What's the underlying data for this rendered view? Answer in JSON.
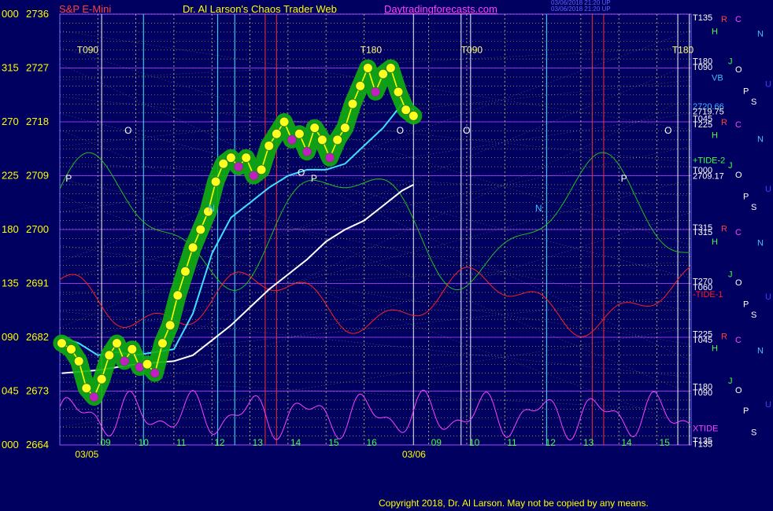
{
  "header": {
    "symbol": "S&P E-Mini",
    "title": "Dr. Al Larson's Chaos Trader Web",
    "site": "Daytradingforecasts.com",
    "timestamp_1": "03/06/2018 21:20 UP",
    "timestamp_2": "03/06/2018 21:20 UP"
  },
  "footer": {
    "copyright": "Copyright 2018, Dr. Al Larson. May not be copied by any means."
  },
  "colors": {
    "background": "#000060",
    "price_text": "#ffff00",
    "header_symbol": "#ff4040",
    "header_title": "#ffff00",
    "header_site": "#ff40ff",
    "grid": "#7070ff",
    "ema_fast": "#40e0ff",
    "ema_slow": "#ffffff",
    "price": "#ffff00",
    "tide_minus_1": "#ff2020",
    "tide_plus_2": "#20c020",
    "xtide": "#ff40ff"
  },
  "chart_data": {
    "type": "line",
    "ylim": [
      2664,
      2736
    ],
    "y_ticks": [
      {
        "angle": "000",
        "price": "2736"
      },
      {
        "angle": "315",
        "price": "2727"
      },
      {
        "angle": "270",
        "price": "2718"
      },
      {
        "angle": "225",
        "price": "2709"
      },
      {
        "angle": "180",
        "price": "2700"
      },
      {
        "angle": "135",
        "price": "2691"
      },
      {
        "angle": "090",
        "price": "2682"
      },
      {
        "angle": "045",
        "price": "2673"
      },
      {
        "angle": "000",
        "price": "2664"
      }
    ],
    "x_hours": [
      {
        "x": 1,
        "label": "09"
      },
      {
        "x": 2,
        "label": "10"
      },
      {
        "x": 3,
        "label": "11"
      },
      {
        "x": 4,
        "label": "12"
      },
      {
        "x": 5,
        "label": "13"
      },
      {
        "x": 6,
        "label": "14"
      },
      {
        "x": 7,
        "label": "15"
      },
      {
        "x": 8,
        "label": "16"
      },
      {
        "x": 9.7,
        "label": "09"
      },
      {
        "x": 10.7,
        "label": "10"
      },
      {
        "x": 11.7,
        "label": "11"
      },
      {
        "x": 12.7,
        "label": "12"
      },
      {
        "x": 13.7,
        "label": "13"
      },
      {
        "x": 14.7,
        "label": "14"
      },
      {
        "x": 15.7,
        "label": "15"
      }
    ],
    "dates": [
      {
        "x": 0.4,
        "label": "03/05"
      },
      {
        "x": 9,
        "label": "03/06"
      }
    ],
    "x_range": [
      0,
      16.6
    ],
    "price_series": {
      "name": "",
      "points": [
        [
          0.05,
          2681
        ],
        [
          0.3,
          2680
        ],
        [
          0.5,
          2678
        ],
        [
          0.7,
          2673.5
        ],
        [
          0.9,
          2672
        ],
        [
          1.1,
          2675
        ],
        [
          1.3,
          2679
        ],
        [
          1.5,
          2681
        ],
        [
          1.7,
          2678
        ],
        [
          1.9,
          2680
        ],
        [
          2.1,
          2677
        ],
        [
          2.3,
          2677.5
        ],
        [
          2.5,
          2676
        ],
        [
          2.7,
          2681
        ],
        [
          2.9,
          2684
        ],
        [
          3.1,
          2689
        ],
        [
          3.3,
          2693
        ],
        [
          3.5,
          2697
        ],
        [
          3.7,
          2700
        ],
        [
          3.9,
          2703
        ],
        [
          4.1,
          2708
        ],
        [
          4.3,
          2711
        ],
        [
          4.5,
          2712
        ],
        [
          4.7,
          2710.5
        ],
        [
          4.9,
          2712
        ],
        [
          5.1,
          2709
        ],
        [
          5.3,
          2710
        ],
        [
          5.5,
          2714
        ],
        [
          5.7,
          2716
        ],
        [
          5.9,
          2718
        ],
        [
          6.1,
          2715
        ],
        [
          6.3,
          2716
        ],
        [
          6.5,
          2713
        ],
        [
          6.7,
          2717
        ],
        [
          6.9,
          2715
        ],
        [
          7.1,
          2712
        ],
        [
          7.3,
          2715
        ],
        [
          7.5,
          2717
        ],
        [
          7.7,
          2721
        ],
        [
          7.9,
          2724
        ],
        [
          8.1,
          2727
        ],
        [
          8.3,
          2723
        ],
        [
          8.5,
          2726
        ],
        [
          8.7,
          2727
        ],
        [
          8.9,
          2723
        ],
        [
          9.1,
          2720
        ],
        [
          9.3,
          2719
        ]
      ]
    },
    "ema_fast": {
      "name": "",
      "points": [
        [
          0.05,
          2682
        ],
        [
          0.5,
          2681
        ],
        [
          1,
          2679
        ],
        [
          1.5,
          2679.5
        ],
        [
          2,
          2679
        ],
        [
          2.5,
          2679.5
        ],
        [
          3,
          2680
        ],
        [
          3.5,
          2686
        ],
        [
          3.8,
          2692
        ],
        [
          4,
          2696
        ],
        [
          4.5,
          2702
        ],
        [
          5,
          2704.5
        ],
        [
          5.5,
          2707
        ],
        [
          6,
          2709
        ],
        [
          6.5,
          2710
        ],
        [
          7,
          2710
        ],
        [
          7.5,
          2711
        ],
        [
          8,
          2714
        ],
        [
          8.5,
          2717
        ],
        [
          9,
          2721
        ],
        [
          9.3,
          2720
        ]
      ]
    },
    "ema_slow": {
      "name": "",
      "points": [
        [
          0.05,
          2676
        ],
        [
          1,
          2676.5
        ],
        [
          2,
          2677.5
        ],
        [
          3,
          2678
        ],
        [
          3.5,
          2679
        ],
        [
          4,
          2681.5
        ],
        [
          4.5,
          2684
        ],
        [
          5,
          2687
        ],
        [
          5.5,
          2690
        ],
        [
          6,
          2692.5
        ],
        [
          6.5,
          2695
        ],
        [
          7,
          2698
        ],
        [
          7.5,
          2700
        ],
        [
          8,
          2701.5
        ],
        [
          8.5,
          2704
        ],
        [
          9,
          2706.5
        ],
        [
          9.3,
          2707.5
        ]
      ]
    },
    "annotations": {
      "left_top": "T090",
      "mid_top": "T180",
      "right_top": "T090",
      "far_right_top": "T180",
      "o_marks": [
        "O",
        "O",
        "O",
        "O",
        "O"
      ],
      "p_marks": [
        "P",
        "P",
        "P"
      ],
      "n_marks": [
        "N",
        "N"
      ]
    },
    "right_labels": [
      {
        "text": "T135",
        "y": 2735.5,
        "color": "#ffffff"
      },
      {
        "text": "R",
        "y": 2735.2,
        "color": "#ff4040"
      },
      {
        "text": "C",
        "y": 2735.2,
        "color": "#ff40ff"
      },
      {
        "text": "H",
        "y": 2733.2,
        "color": "#40ff40"
      },
      {
        "text": "N",
        "y": 2732.8,
        "color": "#40c0ff"
      },
      {
        "text": "T180",
        "y": 2728.2,
        "color": "#ffffff"
      },
      {
        "text": "T090",
        "y": 2727.2,
        "color": "#ffffff"
      },
      {
        "text": "J",
        "y": 2728.2,
        "color": "#40ff40"
      },
      {
        "text": "O",
        "y": 2726.8,
        "color": "#ffffff"
      },
      {
        "text": "VB",
        "y": 2725.4,
        "color": "#40c0ff"
      },
      {
        "text": "P",
        "y": 2723.2,
        "color": "#ffffff"
      },
      {
        "text": "U",
        "y": 2724.4,
        "color": "#4040ff"
      },
      {
        "text": "2720.66",
        "y": 2720.6,
        "color": "#40c0ff"
      },
      {
        "text": "2719.75",
        "y": 2719.8,
        "color": "#ffffff"
      },
      {
        "text": "S",
        "y": 2721.4,
        "color": "#ffffff"
      },
      {
        "text": "T045",
        "y": 2718.6,
        "color": "#ffffff"
      },
      {
        "text": "T225",
        "y": 2717.6,
        "color": "#ffffff"
      },
      {
        "text": "R",
        "y": 2718.0,
        "color": "#ff4040"
      },
      {
        "text": "C",
        "y": 2717.6,
        "color": "#ff40ff"
      },
      {
        "text": "H",
        "y": 2715.8,
        "color": "#40ff40"
      },
      {
        "text": "N",
        "y": 2715.2,
        "color": "#40c0ff"
      },
      {
        "text": "+TIDE-2",
        "y": 2711.6,
        "color": "#40ff40"
      },
      {
        "text": "T000",
        "y": 2710.0,
        "color": "#ffffff"
      },
      {
        "text": "2709.17",
        "y": 2709.0,
        "color": "#ffffff"
      },
      {
        "text": "J",
        "y": 2710.8,
        "color": "#40ff40"
      },
      {
        "text": "O",
        "y": 2709.2,
        "color": "#ffffff"
      },
      {
        "text": "U",
        "y": 2706.8,
        "color": "#4040ff"
      },
      {
        "text": "P",
        "y": 2705.6,
        "color": "#ffffff"
      },
      {
        "text": "S",
        "y": 2703.8,
        "color": "#ffffff"
      },
      {
        "text": "T315",
        "y": 2700.4,
        "color": "#ffffff"
      },
      {
        "text": "T315",
        "y": 2699.6,
        "color": "#ffffff"
      },
      {
        "text": "R",
        "y": 2700.2,
        "color": "#ff4040"
      },
      {
        "text": "C",
        "y": 2699.6,
        "color": "#ff40ff"
      },
      {
        "text": "H",
        "y": 2698.0,
        "color": "#40ff40"
      },
      {
        "text": "N",
        "y": 2697.8,
        "color": "#40c0ff"
      },
      {
        "text": "T270",
        "y": 2691.4,
        "color": "#ffffff"
      },
      {
        "text": "T060",
        "y": 2690.4,
        "color": "#ffffff"
      },
      {
        "text": "J",
        "y": 2692.6,
        "color": "#40ff40"
      },
      {
        "text": "O",
        "y": 2691.2,
        "color": "#ffffff"
      },
      {
        "text": "-TIDE-1",
        "y": 2689.2,
        "color": "#ff2020"
      },
      {
        "text": "U",
        "y": 2688.8,
        "color": "#4040ff"
      },
      {
        "text": "P",
        "y": 2687.6,
        "color": "#ffffff"
      },
      {
        "text": "S",
        "y": 2685.8,
        "color": "#ffffff"
      },
      {
        "text": "T225",
        "y": 2682.6,
        "color": "#ffffff"
      },
      {
        "text": "T045",
        "y": 2681.6,
        "color": "#ffffff"
      },
      {
        "text": "R",
        "y": 2682.2,
        "color": "#ff4040"
      },
      {
        "text": "C",
        "y": 2681.6,
        "color": "#ff40ff"
      },
      {
        "text": "H",
        "y": 2680.2,
        "color": "#40ff40"
      },
      {
        "text": "N",
        "y": 2679.8,
        "color": "#40c0ff"
      },
      {
        "text": "T180",
        "y": 2673.8,
        "color": "#ffffff"
      },
      {
        "text": "T090",
        "y": 2672.8,
        "color": "#ffffff"
      },
      {
        "text": "J",
        "y": 2674.8,
        "color": "#40ff40"
      },
      {
        "text": "O",
        "y": 2673.2,
        "color": "#ffffff"
      },
      {
        "text": "U",
        "y": 2670.8,
        "color": "#4040ff"
      },
      {
        "text": "P",
        "y": 2669.8,
        "color": "#ffffff"
      },
      {
        "text": "XTIDE",
        "y": 2666.8,
        "color": "#ff40ff"
      },
      {
        "text": "S",
        "y": 2666.2,
        "color": "#ffffff"
      },
      {
        "text": "T135",
        "y": 2664.8,
        "color": "#ffffff"
      },
      {
        "text": "T135",
        "y": 2664.2,
        "color": "#ffffff"
      }
    ]
  }
}
